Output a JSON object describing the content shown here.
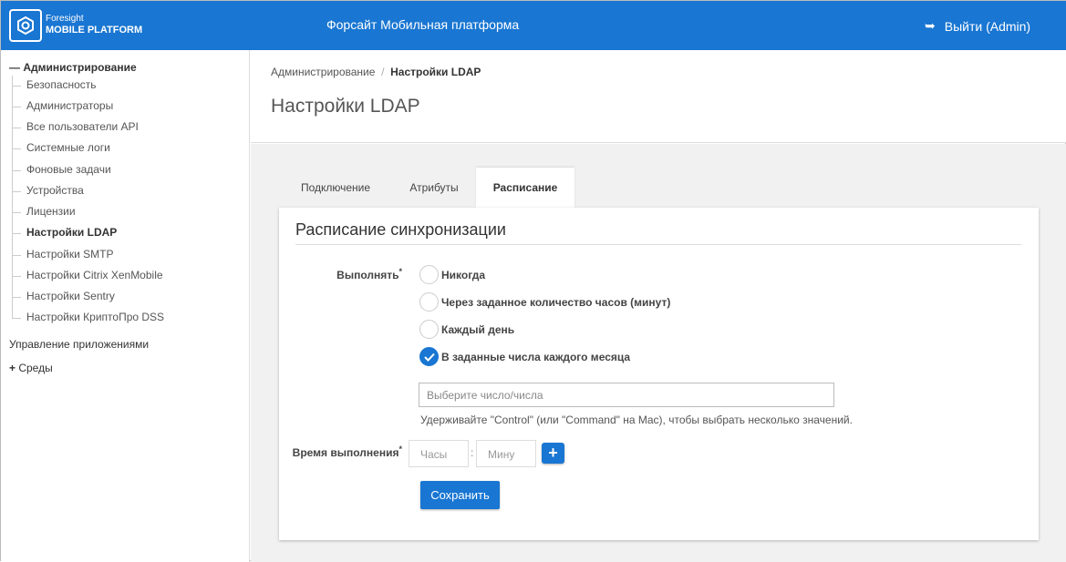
{
  "header": {
    "brand_top": "Foresight",
    "brand_bottom": "MOBILE PLATFORM",
    "title": "Форсайт Мобильная платформа",
    "logout": "Выйти (Admin)"
  },
  "sidebar": {
    "section1": "Администрирование",
    "items": [
      "Безопасность",
      "Администраторы",
      "Все пользователи API",
      "Системные логи",
      "Фоновые задачи",
      "Устройства",
      "Лицензии",
      "Настройки LDAP",
      "Настройки SMTP",
      "Настройки Citrix XenMobile",
      "Настройки Sentry",
      "Настройки КриптоПро DSS"
    ],
    "section2": "Управление приложениями",
    "section3": "Среды"
  },
  "breadcrumb": {
    "parent": "Администрирование",
    "sep": "/",
    "current": "Настройки LDAP"
  },
  "page_title": "Настройки LDAP",
  "tabs": [
    "Подключение",
    "Атрибуты",
    "Расписание"
  ],
  "form": {
    "title": "Расписание синхронизации",
    "run_label": "Выполнять",
    "required": "*",
    "options": [
      "Никогда",
      "Через заданное количество часов (минут)",
      "Каждый день",
      "В заданные числа каждого месяца"
    ],
    "selected_index": 3,
    "days_placeholder": "Выберите число/числа",
    "help": "Удерживайте \"Control\" (или \"Command\" на Mac), чтобы выбрать несколько значений.",
    "time_label": "Время выполнения",
    "hours_placeholder": "Часы",
    "colon": ":",
    "minutes_placeholder": "Мину",
    "add": "+",
    "save": "Сохранить"
  }
}
